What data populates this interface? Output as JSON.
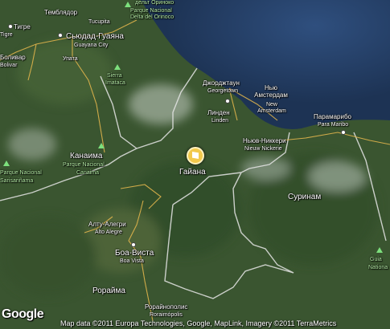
{
  "map": {
    "country_name": "Гайана",
    "places": [
      {
        "key": "tucupita",
        "ru": "Тукупита",
        "en": "Tucupita"
      },
      {
        "key": "tigre",
        "ru": "Тигре",
        "en": "Tigre"
      },
      {
        "key": "temblador",
        "ru": "Темблядор",
        "en": ""
      },
      {
        "key": "ciudad_guayana",
        "ru": "Сьюдад-Гуаяна",
        "en": "Guayana City"
      },
      {
        "key": "bolivar",
        "ru": "Боливар",
        "en": "Bolivar"
      },
      {
        "key": "upata",
        "ru": "Упата",
        "en": ""
      },
      {
        "key": "georgetown",
        "ru": "Джорджтаун",
        "en": "Georgetown"
      },
      {
        "key": "linden",
        "ru": "Линден",
        "en": "Linden"
      },
      {
        "key": "new_amsterdam",
        "ru": "Нью Амстердам",
        "en": "New Amsterdam"
      },
      {
        "key": "paramaribo",
        "ru": "Парамарибо",
        "en": "Para Maribo"
      },
      {
        "key": "nieuw_nickerie",
        "ru": "Ньюв-Никкери",
        "en": "Nieuw Nickerie"
      },
      {
        "key": "alto_alegre",
        "ru": "Алту-Алегри",
        "en": "Alto Alegre"
      },
      {
        "key": "boa_vista",
        "ru": "Боа-Виста",
        "en": "Boa Vista"
      },
      {
        "key": "roraimopolis",
        "ru": "Рорайнополис",
        "en": "Roraimópolis"
      }
    ],
    "regions": [
      {
        "key": "canaima_region",
        "name": "Канаима"
      },
      {
        "key": "suriname",
        "name": "Суринам"
      },
      {
        "key": "roraima",
        "name": "Рорайма"
      }
    ],
    "parks": [
      {
        "key": "orinoco_delta",
        "ru": "дельт Ориноко",
        "en": "Parque Nacional Delta del Orinoco"
      },
      {
        "key": "sierra_imataca",
        "ru": "Sierra",
        "en": "Imataca"
      },
      {
        "key": "canaima_park",
        "ru": "Parque Nacional",
        "en": "Canaima"
      },
      {
        "key": "sarisariñama",
        "ru": "Parque Nacional",
        "en": "Sarisariñama"
      },
      {
        "key": "guia",
        "ru": "Guia",
        "en": "Nationa"
      }
    ]
  },
  "branding": {
    "logo_text": "Google"
  },
  "attribution": "Map data ©2011 Europa Technologies, Google, MapLink, Imagery ©2011 TerraMetrics"
}
